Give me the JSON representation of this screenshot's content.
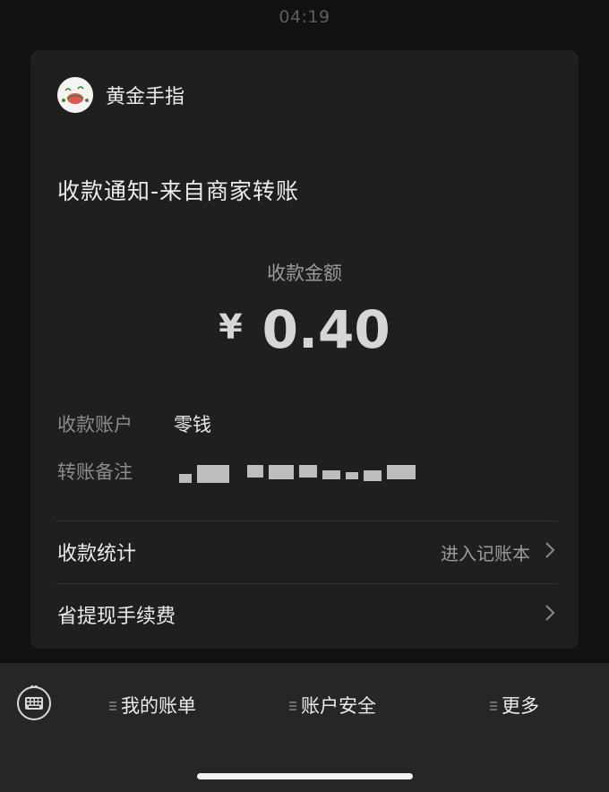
{
  "status_bar": {
    "time": "04:19"
  },
  "card": {
    "app_name": "黄金手指",
    "title": "收款通知-来自商家转账",
    "amount_label": "收款金额",
    "currency": "¥",
    "amount": "0.40",
    "info": [
      {
        "key": "收款账户",
        "value": "零钱"
      },
      {
        "key": "转账备注",
        "value": ""
      }
    ],
    "menu": [
      {
        "label": "收款统计",
        "right": "进入记账本"
      },
      {
        "label": "省提现手续费",
        "right": ""
      }
    ]
  },
  "bottom_menu": {
    "items": [
      "我的账单",
      "账户安全",
      "更多"
    ]
  },
  "colors": {
    "background": "#111111",
    "card": "#1f1f1f",
    "bottom_bar": "#262626",
    "text_primary": "#ececec",
    "text_secondary": "#9b9b9b"
  },
  "icons": [
    "app-avatar-icon",
    "chevron-right-icon",
    "keyboard-icon",
    "menu-lines-icon"
  ]
}
